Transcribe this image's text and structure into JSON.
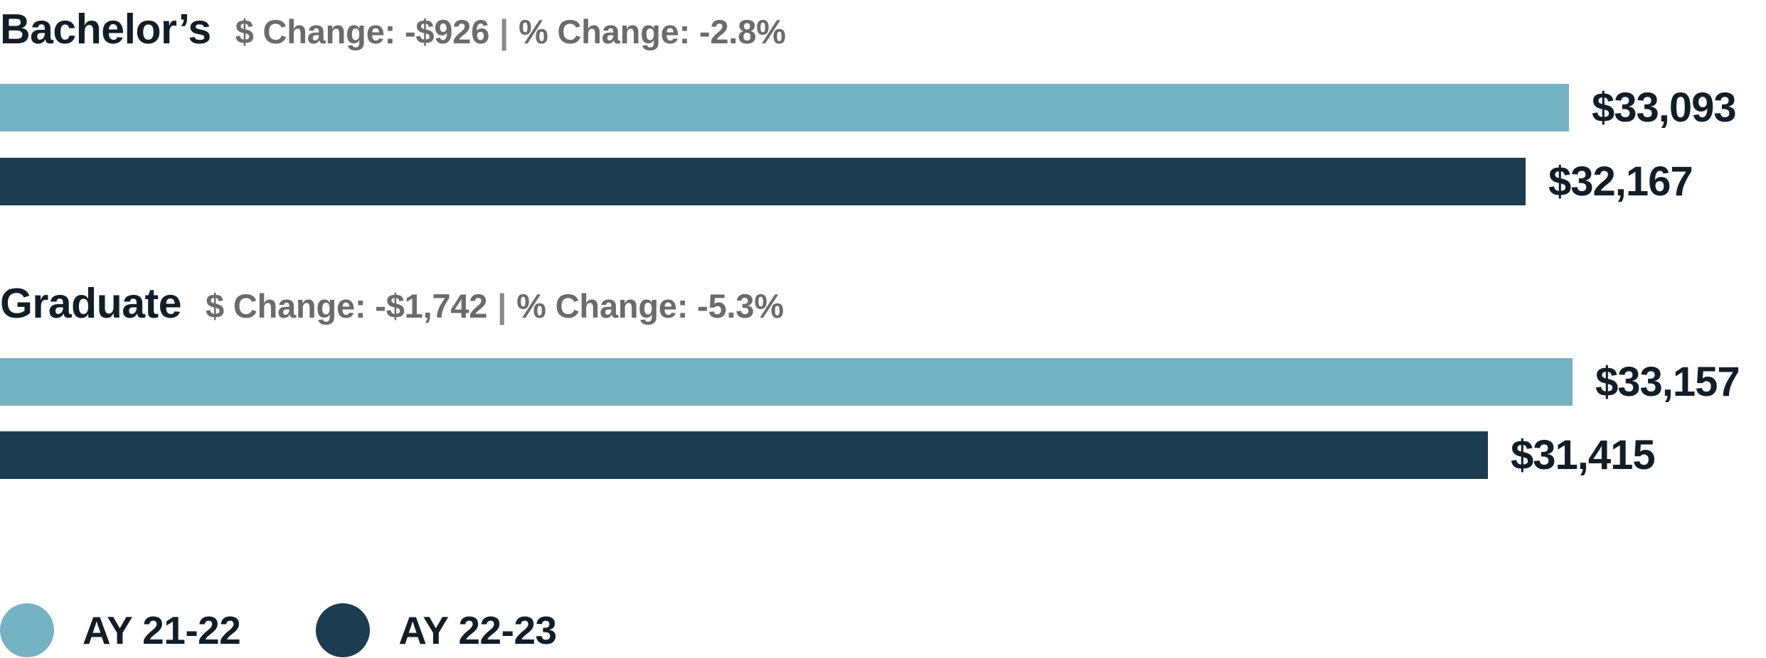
{
  "chart_data": {
    "type": "bar",
    "orientation": "horizontal",
    "title": "",
    "xlabel": "",
    "ylabel": "",
    "grid": false,
    "legend_position": "bottom-left",
    "value_prefix": "$",
    "xlim": [
      0,
      34400
    ],
    "categories": [
      "Bachelor's",
      "Graduate"
    ],
    "series": [
      {
        "name": "AY 21-22",
        "color": "#74b3c4",
        "values": [
          33093,
          33157
        ]
      },
      {
        "name": "AY 22-23",
        "color": "#1c3d51",
        "values": [
          32167,
          31415
        ]
      }
    ],
    "groups": [
      {
        "name": "Bachelor's",
        "title": "Bachelor’s",
        "dollar_change_label": "$ Change: -$926",
        "percent_change_label": "% Change: -2.8%",
        "separator": "|",
        "dollar_change": -926,
        "percent_change": -2.8,
        "bars": [
          {
            "series": "AY 21-22",
            "value": 33093,
            "value_label": "$33,093",
            "color": "#74b3c4"
          },
          {
            "series": "AY 22-23",
            "value": 32167,
            "value_label": "$32,167",
            "color": "#1c3d51"
          }
        ]
      },
      {
        "name": "Graduate",
        "title": "Graduate",
        "dollar_change_label": "$ Change: -$1,742",
        "percent_change_label": "% Change: -5.3%",
        "separator": "|",
        "dollar_change": -1742,
        "percent_change": -5.3,
        "bars": [
          {
            "series": "AY 21-22",
            "value": 33157,
            "value_label": "$33,157",
            "color": "#74b3c4"
          },
          {
            "series": "AY 22-23",
            "value": 31415,
            "value_label": "$31,415",
            "color": "#1c3d51"
          }
        ]
      }
    ]
  },
  "legend": {
    "items": [
      {
        "label": "AY 21-22",
        "color": "#74b3c4"
      },
      {
        "label": "AY 22-23",
        "color": "#1c3d51"
      }
    ]
  },
  "colors": {
    "series_prev": "#74b3c4",
    "series_curr": "#1c3d51",
    "title_text": "#101e28",
    "stats_text": "#6b6b6b",
    "value_text": "#101e28",
    "background": "#ffffff"
  }
}
